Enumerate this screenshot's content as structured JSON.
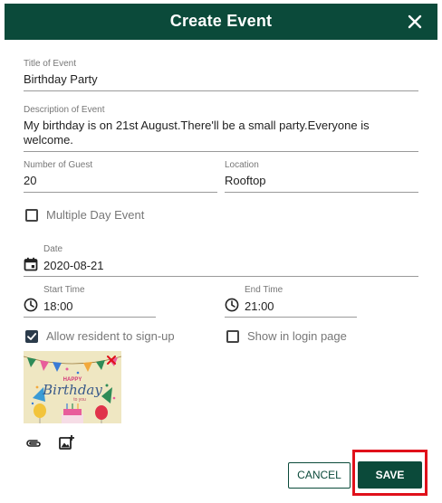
{
  "dialog": {
    "title": "Create Event",
    "close_icon": "close-icon"
  },
  "form": {
    "title_of_event": {
      "label": "Title of Event",
      "value": "Birthday Party"
    },
    "description": {
      "label": "Description of Event",
      "value_line1": "My birthday is on 21st August.There'll be a small party.Everyone is",
      "value_line2": "welcome."
    },
    "number_of_guest": {
      "label": "Number of Guest",
      "value": "20"
    },
    "location": {
      "label": "Location",
      "value": "Rooftop"
    },
    "multiple_day_event": {
      "label": "Multiple Day Event",
      "checked": false
    },
    "date": {
      "label": "Date",
      "value": "2020-08-21",
      "icon": "calendar-icon"
    },
    "start_time": {
      "label": "Start Time",
      "value": "18:00",
      "icon": "clock-icon"
    },
    "end_time": {
      "label": "End Time",
      "value": "21:00",
      "icon": "clock-icon"
    },
    "allow_resident_signup": {
      "label": "Allow resident to sign-up",
      "checked": true
    },
    "show_in_login_page": {
      "label": "Show in login page",
      "checked": false
    },
    "image": {
      "alt": "birthday-image",
      "text_happy": "HAPPY",
      "text_birthday": "Birthday",
      "text_to_you": "to you",
      "remove_icon": "close-icon"
    },
    "attachment_icon": "paperclip-icon",
    "add_image_icon": "add-image-icon"
  },
  "actions": {
    "cancel_label": "CANCEL",
    "save_label": "SAVE"
  },
  "colors": {
    "primary": "#0b4a3a",
    "highlight": "#e0101a"
  }
}
